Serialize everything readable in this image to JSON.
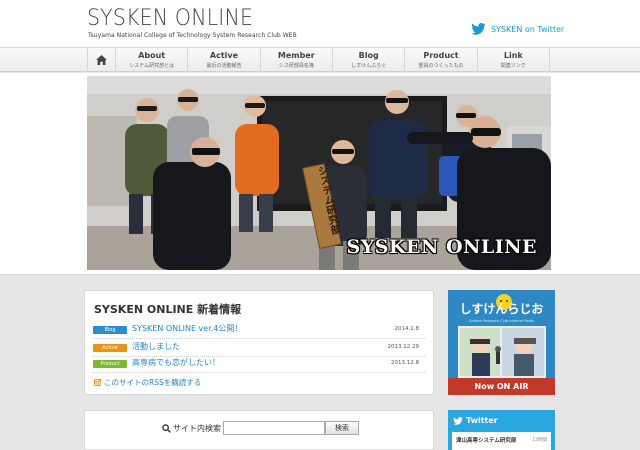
{
  "header": {
    "logo": "SYSKEN ONLINE",
    "subtitle": "Tsuyama National College of Technology  System Research Club WEB",
    "twitter_label": "SYSKEN on Twitter"
  },
  "nav": {
    "home_icon": "home-icon",
    "items": [
      {
        "title": "About",
        "sub": "システム研究部とは"
      },
      {
        "title": "Active",
        "sub": "最近の活動報告"
      },
      {
        "title": "Member",
        "sub": "シス研部員名簿"
      },
      {
        "title": "Blog",
        "sub": "しすけんぶろぐ"
      },
      {
        "title": "Product",
        "sub": "部員のつくったもの"
      },
      {
        "title": "Link",
        "sub": "関連リンク"
      }
    ]
  },
  "hero": {
    "caption": "SYSKEN ONLINE",
    "sign_text": "システム研究部"
  },
  "news": {
    "title": "SYSKEN ONLINE 新着情報",
    "items": [
      {
        "badge": "Blog",
        "badge_color": "#2a8fd0",
        "text": "SYSKEN ONLINE ver.4公開！",
        "date": "2014.1.8"
      },
      {
        "badge": "Active",
        "badge_color": "#e89312",
        "text": "活動しました",
        "date": "2013.12.29"
      },
      {
        "badge": "Product",
        "badge_color": "#7bb82b",
        "text": "高専病でも恋がしたい！",
        "date": "2013.12.8"
      }
    ],
    "rss_label": "このサイトのRSSを購読する"
  },
  "search": {
    "label": "サイト内検索",
    "placeholder": "",
    "button": "検索"
  },
  "banner": {
    "title": "しすけんらじお",
    "subtitle": "System Research Club  Internet Radio",
    "on_air": "Now ON AIR"
  },
  "twitter_widget": {
    "title": "Twitter",
    "account": "津山高専システム研究部",
    "time": "12時間"
  },
  "colors": {
    "accent": "#1d9bd1",
    "banner_bg": "#2d88c3",
    "twitter_bg": "#2aa6e0"
  }
}
